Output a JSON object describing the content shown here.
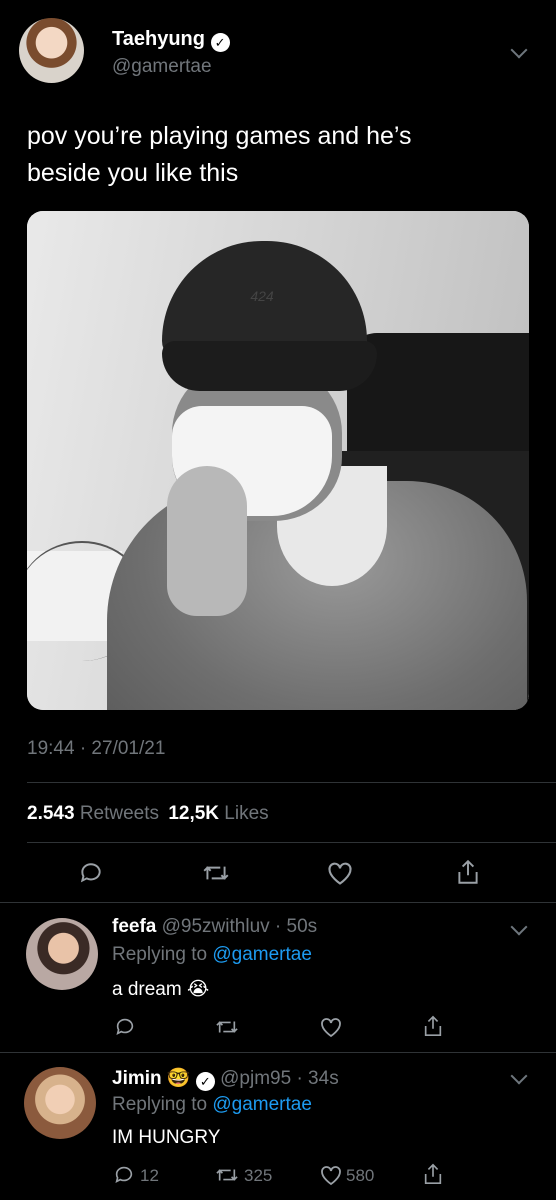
{
  "tweet": {
    "display_name": "Taehyung",
    "handle": "@gamertae",
    "text_line1": "pov you’re playing games and he’s",
    "text_line2": "beside you like this",
    "photo_cap_logo": "424",
    "timestamp": "19:44 · 27/01/21",
    "retweets_count": "2.543",
    "retweets_label": "Retweets",
    "likes_count": "12,5K",
    "likes_label": "Likes"
  },
  "replies": [
    {
      "display_name": "feefa",
      "handle_time": "@95zwithluv · 50s",
      "replying_prefix": "Replying to",
      "replying_to": "@gamertae",
      "text": "a dream",
      "emoji": "😭"
    },
    {
      "display_name": "Jimin",
      "name_emoji": "🤓",
      "handle_time": "@pjm95 · 34s",
      "replying_prefix": "Replying to",
      "replying_to": "@gamertae",
      "text": "IM HUNGRY",
      "reply_count": "12",
      "retweet_count": "325",
      "like_count": "580"
    }
  ],
  "icons": {
    "verified": "verified-badge-icon",
    "reply": "reply-icon",
    "retweet": "retweet-icon",
    "like": "heart-icon",
    "share": "share-icon",
    "more": "chevron-down-icon"
  },
  "colors": {
    "background": "#000000",
    "text": "#ffffff",
    "muted": "#71767b",
    "link": "#1d9bf0",
    "divider": "#2f3336"
  }
}
